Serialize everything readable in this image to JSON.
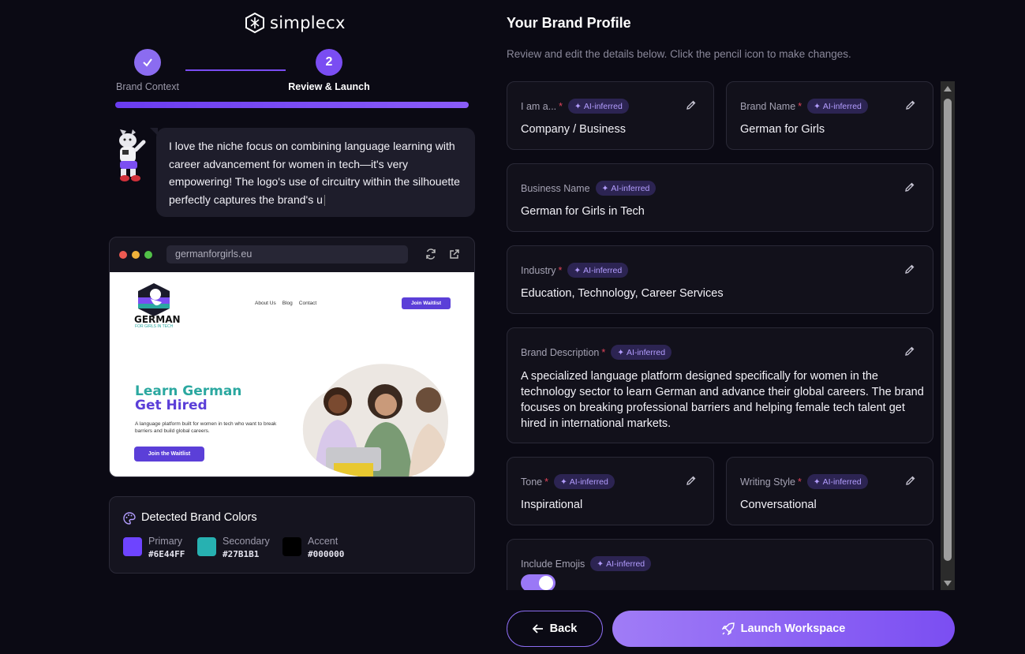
{
  "app": {
    "name": "simplecx"
  },
  "stepper": {
    "steps": [
      {
        "label": "Brand Context",
        "state": "done"
      },
      {
        "label": "Review & Launch",
        "number": "2",
        "state": "active"
      }
    ]
  },
  "chat": {
    "message": "I love the niche focus on combining language learning with career advancement for women in tech—it's very empowering! The logo's use of circuitry within the silhouette perfectly captures the brand's u"
  },
  "browser": {
    "url": "germanforgirls.eu",
    "site": {
      "logo_word": "GERMAN",
      "logo_tagline": "FOR GIRLS IN TECH",
      "nav": [
        "About Us",
        "Blog",
        "Contact"
      ],
      "join_label": "Join Waitlist",
      "headline_1": "Learn German",
      "headline_2": "Get Hired",
      "paragraph": "A language platform built for women in tech who want to break barriers and build global careers.",
      "cta_label": "Join the Waitlist"
    }
  },
  "brand_colors": {
    "title": "Detected Brand Colors",
    "items": [
      {
        "name": "Primary",
        "hex": "#6E44FF"
      },
      {
        "name": "Secondary",
        "hex": "#27B1B1"
      },
      {
        "name": "Accent",
        "hex": "#000000"
      }
    ]
  },
  "profile": {
    "title": "Your Brand Profile",
    "subtitle": "Review and edit the details below. Click the pencil icon to make changes.",
    "ai_badge": "AI-inferred",
    "fields": {
      "iam": {
        "label": "I am a...",
        "value": "Company / Business"
      },
      "brand_name": {
        "label": "Brand Name",
        "value": "German for Girls"
      },
      "business_name": {
        "label": "Business Name",
        "value": "German for Girls in Tech"
      },
      "industry": {
        "label": "Industry",
        "value": "Education, Technology, Career Services"
      },
      "description": {
        "label": "Brand Description",
        "value": "A specialized language platform designed specifically for women in the technology sector to learn German and advance their global careers. The brand focuses on breaking professional barriers and helping female tech talent get hired in international markets."
      },
      "tone": {
        "label": "Tone",
        "value": "Inspirational"
      },
      "writing_style": {
        "label": "Writing Style",
        "value": "Conversational"
      },
      "emojis": {
        "label": "Include Emojis",
        "enabled": true
      }
    }
  },
  "actions": {
    "back": "Back",
    "launch": "Launch Workspace"
  },
  "theme": {
    "accent": "#7a4df2",
    "required": "#e0445a",
    "badge_text": "#b39dff"
  }
}
